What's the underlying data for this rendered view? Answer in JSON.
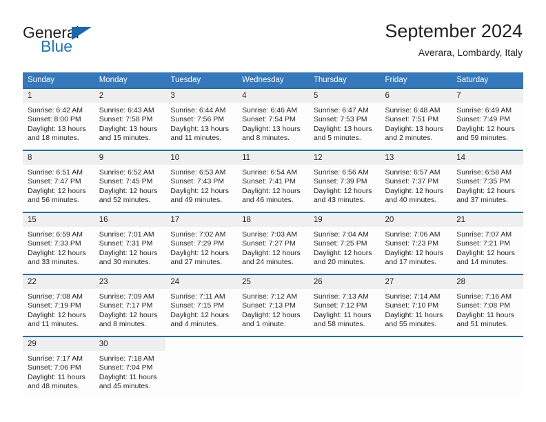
{
  "brand": {
    "name_part1": "General",
    "name_part2": "Blue"
  },
  "header": {
    "title": "September 2024",
    "location": "Averara, Lombardy, Italy"
  },
  "calendar": {
    "weekdays": [
      "Sunday",
      "Monday",
      "Tuesday",
      "Wednesday",
      "Thursday",
      "Friday",
      "Saturday"
    ],
    "accent_color": "#3678bc",
    "row_border_color": "#1f6cb0",
    "daynum_background": "#efefef",
    "weeks": [
      [
        {
          "day": "1",
          "sunrise": "Sunrise: 6:42 AM",
          "sunset": "Sunset: 8:00 PM",
          "daylight_line1": "Daylight: 13 hours",
          "daylight_line2": "and 18 minutes."
        },
        {
          "day": "2",
          "sunrise": "Sunrise: 6:43 AM",
          "sunset": "Sunset: 7:58 PM",
          "daylight_line1": "Daylight: 13 hours",
          "daylight_line2": "and 15 minutes."
        },
        {
          "day": "3",
          "sunrise": "Sunrise: 6:44 AM",
          "sunset": "Sunset: 7:56 PM",
          "daylight_line1": "Daylight: 13 hours",
          "daylight_line2": "and 11 minutes."
        },
        {
          "day": "4",
          "sunrise": "Sunrise: 6:46 AM",
          "sunset": "Sunset: 7:54 PM",
          "daylight_line1": "Daylight: 13 hours",
          "daylight_line2": "and 8 minutes."
        },
        {
          "day": "5",
          "sunrise": "Sunrise: 6:47 AM",
          "sunset": "Sunset: 7:53 PM",
          "daylight_line1": "Daylight: 13 hours",
          "daylight_line2": "and 5 minutes."
        },
        {
          "day": "6",
          "sunrise": "Sunrise: 6:48 AM",
          "sunset": "Sunset: 7:51 PM",
          "daylight_line1": "Daylight: 13 hours",
          "daylight_line2": "and 2 minutes."
        },
        {
          "day": "7",
          "sunrise": "Sunrise: 6:49 AM",
          "sunset": "Sunset: 7:49 PM",
          "daylight_line1": "Daylight: 12 hours",
          "daylight_line2": "and 59 minutes."
        }
      ],
      [
        {
          "day": "8",
          "sunrise": "Sunrise: 6:51 AM",
          "sunset": "Sunset: 7:47 PM",
          "daylight_line1": "Daylight: 12 hours",
          "daylight_line2": "and 56 minutes."
        },
        {
          "day": "9",
          "sunrise": "Sunrise: 6:52 AM",
          "sunset": "Sunset: 7:45 PM",
          "daylight_line1": "Daylight: 12 hours",
          "daylight_line2": "and 52 minutes."
        },
        {
          "day": "10",
          "sunrise": "Sunrise: 6:53 AM",
          "sunset": "Sunset: 7:43 PM",
          "daylight_line1": "Daylight: 12 hours",
          "daylight_line2": "and 49 minutes."
        },
        {
          "day": "11",
          "sunrise": "Sunrise: 6:54 AM",
          "sunset": "Sunset: 7:41 PM",
          "daylight_line1": "Daylight: 12 hours",
          "daylight_line2": "and 46 minutes."
        },
        {
          "day": "12",
          "sunrise": "Sunrise: 6:56 AM",
          "sunset": "Sunset: 7:39 PM",
          "daylight_line1": "Daylight: 12 hours",
          "daylight_line2": "and 43 minutes."
        },
        {
          "day": "13",
          "sunrise": "Sunrise: 6:57 AM",
          "sunset": "Sunset: 7:37 PM",
          "daylight_line1": "Daylight: 12 hours",
          "daylight_line2": "and 40 minutes."
        },
        {
          "day": "14",
          "sunrise": "Sunrise: 6:58 AM",
          "sunset": "Sunset: 7:35 PM",
          "daylight_line1": "Daylight: 12 hours",
          "daylight_line2": "and 37 minutes."
        }
      ],
      [
        {
          "day": "15",
          "sunrise": "Sunrise: 6:59 AM",
          "sunset": "Sunset: 7:33 PM",
          "daylight_line1": "Daylight: 12 hours",
          "daylight_line2": "and 33 minutes."
        },
        {
          "day": "16",
          "sunrise": "Sunrise: 7:01 AM",
          "sunset": "Sunset: 7:31 PM",
          "daylight_line1": "Daylight: 12 hours",
          "daylight_line2": "and 30 minutes."
        },
        {
          "day": "17",
          "sunrise": "Sunrise: 7:02 AM",
          "sunset": "Sunset: 7:29 PM",
          "daylight_line1": "Daylight: 12 hours",
          "daylight_line2": "and 27 minutes."
        },
        {
          "day": "18",
          "sunrise": "Sunrise: 7:03 AM",
          "sunset": "Sunset: 7:27 PM",
          "daylight_line1": "Daylight: 12 hours",
          "daylight_line2": "and 24 minutes."
        },
        {
          "day": "19",
          "sunrise": "Sunrise: 7:04 AM",
          "sunset": "Sunset: 7:25 PM",
          "daylight_line1": "Daylight: 12 hours",
          "daylight_line2": "and 20 minutes."
        },
        {
          "day": "20",
          "sunrise": "Sunrise: 7:06 AM",
          "sunset": "Sunset: 7:23 PM",
          "daylight_line1": "Daylight: 12 hours",
          "daylight_line2": "and 17 minutes."
        },
        {
          "day": "21",
          "sunrise": "Sunrise: 7:07 AM",
          "sunset": "Sunset: 7:21 PM",
          "daylight_line1": "Daylight: 12 hours",
          "daylight_line2": "and 14 minutes."
        }
      ],
      [
        {
          "day": "22",
          "sunrise": "Sunrise: 7:08 AM",
          "sunset": "Sunset: 7:19 PM",
          "daylight_line1": "Daylight: 12 hours",
          "daylight_line2": "and 11 minutes."
        },
        {
          "day": "23",
          "sunrise": "Sunrise: 7:09 AM",
          "sunset": "Sunset: 7:17 PM",
          "daylight_line1": "Daylight: 12 hours",
          "daylight_line2": "and 8 minutes."
        },
        {
          "day": "24",
          "sunrise": "Sunrise: 7:11 AM",
          "sunset": "Sunset: 7:15 PM",
          "daylight_line1": "Daylight: 12 hours",
          "daylight_line2": "and 4 minutes."
        },
        {
          "day": "25",
          "sunrise": "Sunrise: 7:12 AM",
          "sunset": "Sunset: 7:13 PM",
          "daylight_line1": "Daylight: 12 hours",
          "daylight_line2": "and 1 minute."
        },
        {
          "day": "26",
          "sunrise": "Sunrise: 7:13 AM",
          "sunset": "Sunset: 7:12 PM",
          "daylight_line1": "Daylight: 11 hours",
          "daylight_line2": "and 58 minutes."
        },
        {
          "day": "27",
          "sunrise": "Sunrise: 7:14 AM",
          "sunset": "Sunset: 7:10 PM",
          "daylight_line1": "Daylight: 11 hours",
          "daylight_line2": "and 55 minutes."
        },
        {
          "day": "28",
          "sunrise": "Sunrise: 7:16 AM",
          "sunset": "Sunset: 7:08 PM",
          "daylight_line1": "Daylight: 11 hours",
          "daylight_line2": "and 51 minutes."
        }
      ],
      [
        {
          "day": "29",
          "sunrise": "Sunrise: 7:17 AM",
          "sunset": "Sunset: 7:06 PM",
          "daylight_line1": "Daylight: 11 hours",
          "daylight_line2": "and 48 minutes."
        },
        {
          "day": "30",
          "sunrise": "Sunrise: 7:18 AM",
          "sunset": "Sunset: 7:04 PM",
          "daylight_line1": "Daylight: 11 hours",
          "daylight_line2": "and 45 minutes."
        },
        {
          "day": "",
          "sunrise": "",
          "sunset": "",
          "daylight_line1": "",
          "daylight_line2": ""
        },
        {
          "day": "",
          "sunrise": "",
          "sunset": "",
          "daylight_line1": "",
          "daylight_line2": ""
        },
        {
          "day": "",
          "sunrise": "",
          "sunset": "",
          "daylight_line1": "",
          "daylight_line2": ""
        },
        {
          "day": "",
          "sunrise": "",
          "sunset": "",
          "daylight_line1": "",
          "daylight_line2": ""
        },
        {
          "day": "",
          "sunrise": "",
          "sunset": "",
          "daylight_line1": "",
          "daylight_line2": ""
        }
      ]
    ]
  }
}
